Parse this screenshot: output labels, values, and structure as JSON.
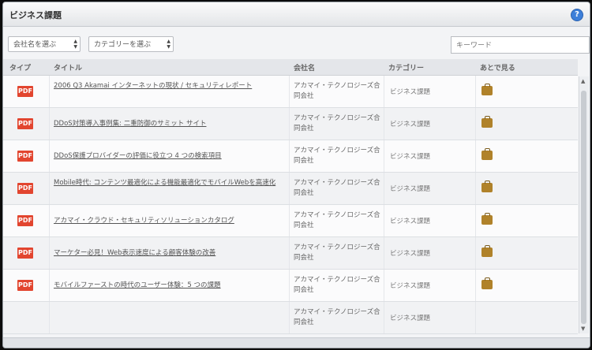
{
  "panel": {
    "title": "ビジネス課題",
    "help_glyph": "?"
  },
  "filters": {
    "company_select": "会社名を選ぶ",
    "category_select": "カテゴリーを選ぶ",
    "keyword_placeholder": "キーワード"
  },
  "table": {
    "columns": [
      "タイプ",
      "タイトル",
      "会社名",
      "カテゴリー",
      "あとで見る"
    ],
    "rows": [
      {
        "type": "PDF",
        "title": "2006 Q3 Akamai インターネットの現状 / セキュリティレポート",
        "company": "アカマイ・テクノロジーズ合同会社",
        "category": "ビジネス課題",
        "later": true
      },
      {
        "type": "PDF",
        "title": "DDoS対策導入事例集: 二重防御のサミット サイト",
        "company": "アカマイ・テクノロジーズ合同会社",
        "category": "ビジネス課題",
        "later": true
      },
      {
        "type": "PDF",
        "title": "DDoS保護プロバイダーの評価に役立つ 4 つの検索項目",
        "company": "アカマイ・テクノロジーズ合同会社",
        "category": "ビジネス課題",
        "later": true
      },
      {
        "type": "PDF",
        "title": "Mobile時代: コンテンツ最適化による機能最適化でモバイルWebを高速化",
        "company": "アカマイ・テクノロジーズ合同会社",
        "category": "ビジネス課題",
        "later": true
      },
      {
        "type": "PDF",
        "title": "アカマイ・クラウド・セキュリティソリューションカタログ",
        "company": "アカマイ・テクノロジーズ合同会社",
        "category": "ビジネス課題",
        "later": true
      },
      {
        "type": "PDF",
        "title": "マーケター必見！Web表示速度による顧客体験の改善",
        "company": "アカマイ・テクノロジーズ合同会社",
        "category": "ビジネス課題",
        "later": true
      },
      {
        "type": "PDF",
        "title": "モバイルファーストの時代のユーザー体験：5 つの課題",
        "company": "アカマイ・テクノロジーズ合同会社",
        "category": "ビジネス課題",
        "later": true
      },
      {
        "type": "",
        "title": "",
        "company": "アカマイ・テクノロジーズ合同会社",
        "category": "ビジネス課題",
        "later": false
      }
    ]
  },
  "colors": {
    "pdf_badge": "#e2452f",
    "help_icon": "#3d7fd9",
    "briefcase": "#b0822a"
  }
}
